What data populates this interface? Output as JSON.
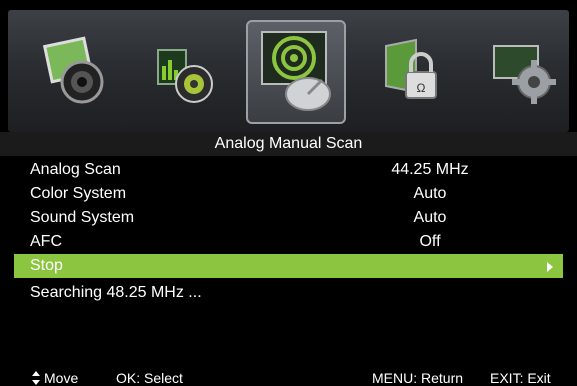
{
  "menu": {
    "icons": [
      "picture-icon",
      "sound-icon",
      "channel-icon",
      "lock-icon",
      "setup-icon"
    ],
    "active_index": 2
  },
  "title": "Analog Manual Scan",
  "rows": [
    {
      "label": "Analog Scan",
      "value": "44.25 MHz"
    },
    {
      "label": "Color System",
      "value": "Auto"
    },
    {
      "label": "Sound System",
      "value": "Auto"
    },
    {
      "label": "AFC",
      "value": "Off"
    }
  ],
  "highlighted": {
    "label": "Stop"
  },
  "status": "Searching 48.25 MHz ...",
  "footer": {
    "move": "Move",
    "select": "OK: Select",
    "return": "MENU: Return",
    "exit": "EXIT: Exit"
  },
  "colors": {
    "highlight": "#8cc53f",
    "background": "#000000"
  }
}
